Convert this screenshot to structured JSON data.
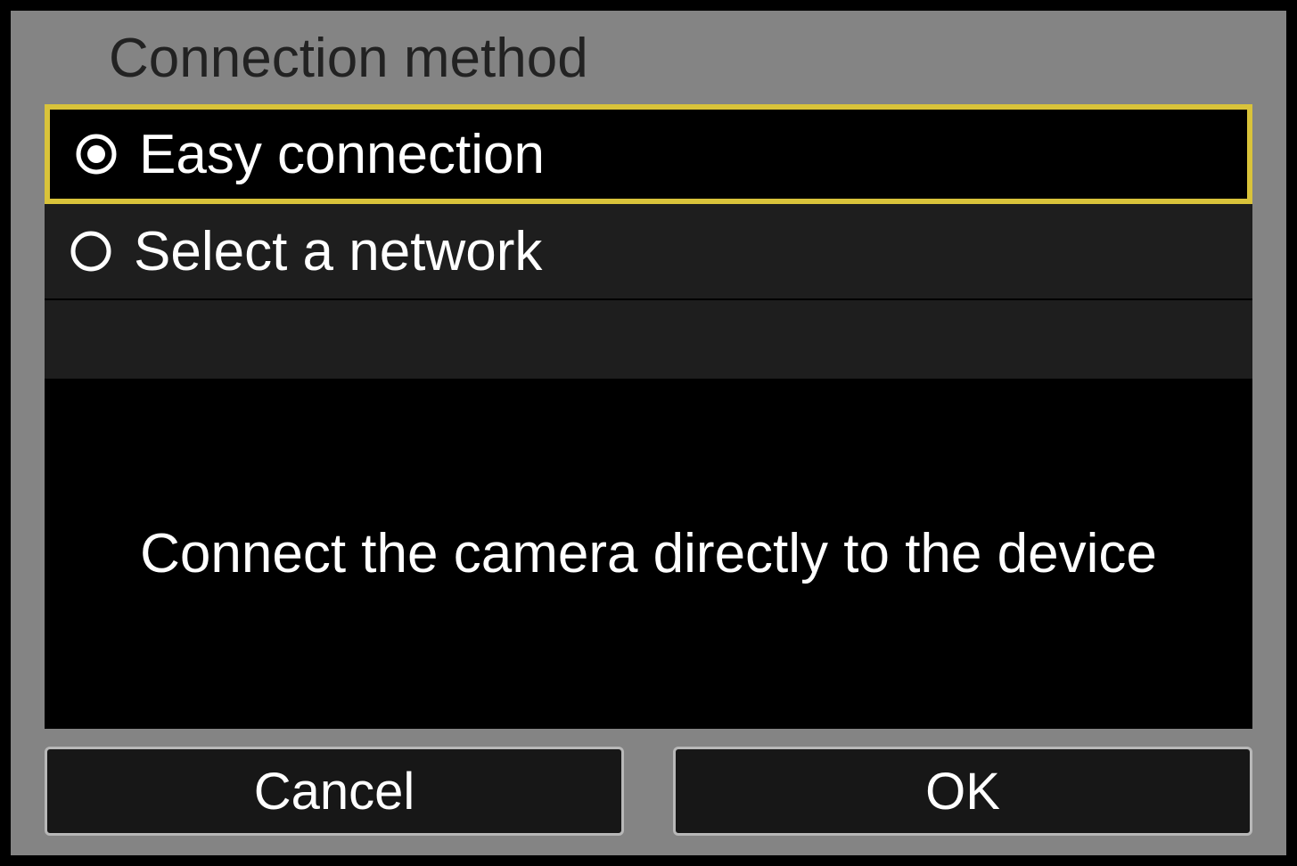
{
  "title": "Connection method",
  "options": [
    {
      "label": "Easy connection",
      "selected": true
    },
    {
      "label": "Select a network",
      "selected": false
    }
  ],
  "description": "Connect the camera directly to the device",
  "buttons": {
    "cancel": "Cancel",
    "ok": "OK"
  },
  "colors": {
    "highlight": "#d9c33a",
    "background_gray": "#848484",
    "panel_dark": "#1e1e1e"
  }
}
